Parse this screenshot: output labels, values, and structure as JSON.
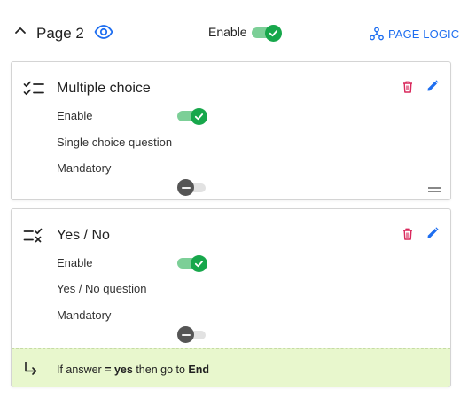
{
  "header": {
    "title": "Page 2",
    "enable_label": "Enable",
    "page_logic_label": "PAGE LOGIC",
    "enabled": true
  },
  "colors": {
    "accent_blue": "#1e6ef0",
    "toggle_green": "#17a74b",
    "delete_red": "#d9285c",
    "logic_bg": "#e8f7cd"
  },
  "questions": [
    {
      "icon": "checklist-icon",
      "title": "Multiple choice",
      "enable_label": "Enable",
      "enabled": true,
      "type_text": "Single choice question",
      "mandatory_label": "Mandatory",
      "mandatory": false
    },
    {
      "icon": "yes-no-icon",
      "title": "Yes / No",
      "enable_label": "Enable",
      "enabled": true,
      "type_text": "Yes / No question",
      "mandatory_label": "Mandatory",
      "mandatory": false,
      "logic": {
        "prefix": "If answer",
        "condition": "= yes",
        "middle": "then go to",
        "target": "End"
      }
    }
  ]
}
